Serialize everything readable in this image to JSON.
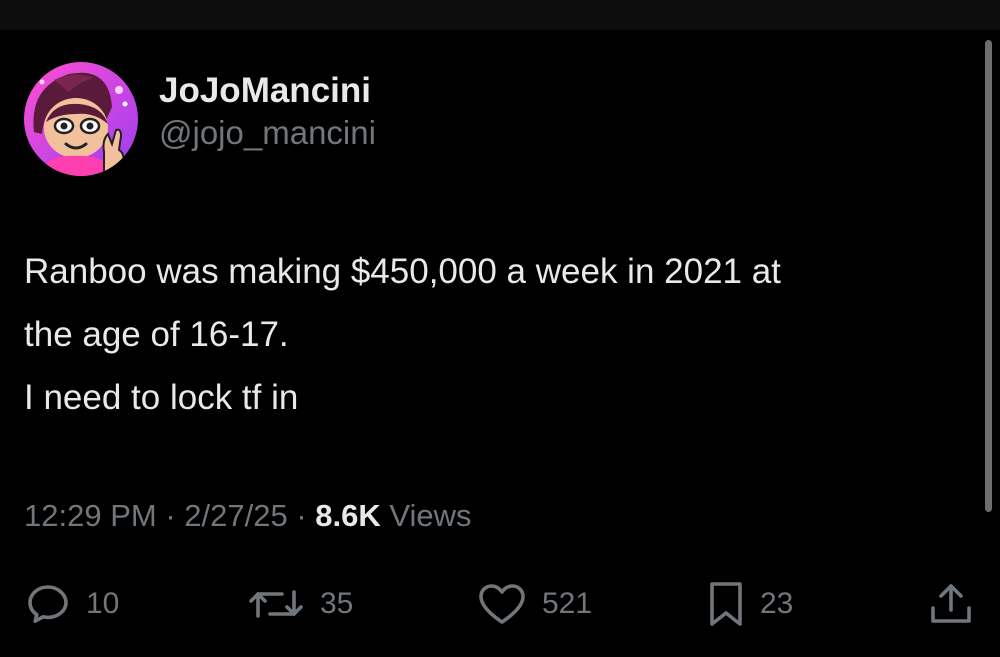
{
  "author": {
    "display_name": "JoJoMancini",
    "handle": "@jojo_mancini"
  },
  "tweet": {
    "lines": [
      "Ranboo was making $450,000 a week in 2021 at",
      "the age of 16-17.",
      "I need to lock tf in"
    ]
  },
  "meta": {
    "time": "12:29 PM",
    "separator": " · ",
    "date": "2/27/25",
    "views_count": "8.6K",
    "views_label": " Views"
  },
  "actions": {
    "reply": {
      "icon": "reply-icon",
      "count": "10"
    },
    "retweet": {
      "icon": "retweet-icon",
      "count": "35"
    },
    "like": {
      "icon": "heart-icon",
      "count": "521"
    },
    "bookmark": {
      "icon": "bookmark-icon",
      "count": "23"
    },
    "share": {
      "icon": "share-icon"
    }
  },
  "colors": {
    "background": "#000000",
    "text_primary": "#e7e9ea",
    "text_secondary": "#71767b"
  }
}
